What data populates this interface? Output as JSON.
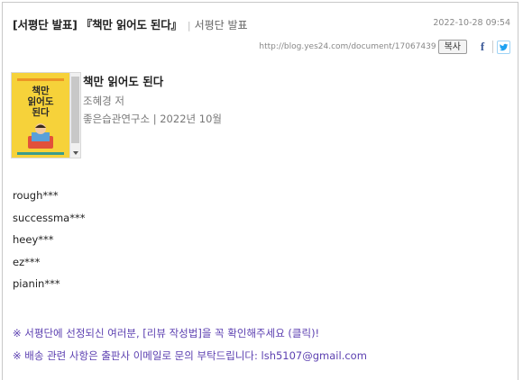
{
  "post": {
    "title": "[서평단 발표] 『책만 읽어도 된다』",
    "separator": "|",
    "category": "서평단 발표",
    "date": "2022-10-28 09:54",
    "url": "http://blog.yes24.com/document/17067439",
    "copy_label": "복사",
    "icons": [
      "facebook-icon",
      "twitter-icon"
    ]
  },
  "book": {
    "cover_lines": [
      "책만",
      "읽어도",
      "된다"
    ],
    "title": "책만 읽어도 된다",
    "author": "조혜경 저",
    "publisher_line": "좋은습관연구소 | 2022년 10월"
  },
  "winners": [
    "rough***",
    "successma***",
    "heey***",
    "ez***",
    "pianin***"
  ],
  "notices": [
    "※ 서평단에 선정되신 여러분, [리뷰 작성법]을 꼭 확인해주세요 (클릭)!",
    "※ 배송 관련 사항은 출판사 이메일로 문의 부탁드립니다:  lsh5107@gmail.com"
  ],
  "colors": {
    "notice": "#5b3fb0",
    "cover": "#f6d23a",
    "facebook": "#3b5998",
    "twitter": "#1da1f2"
  }
}
